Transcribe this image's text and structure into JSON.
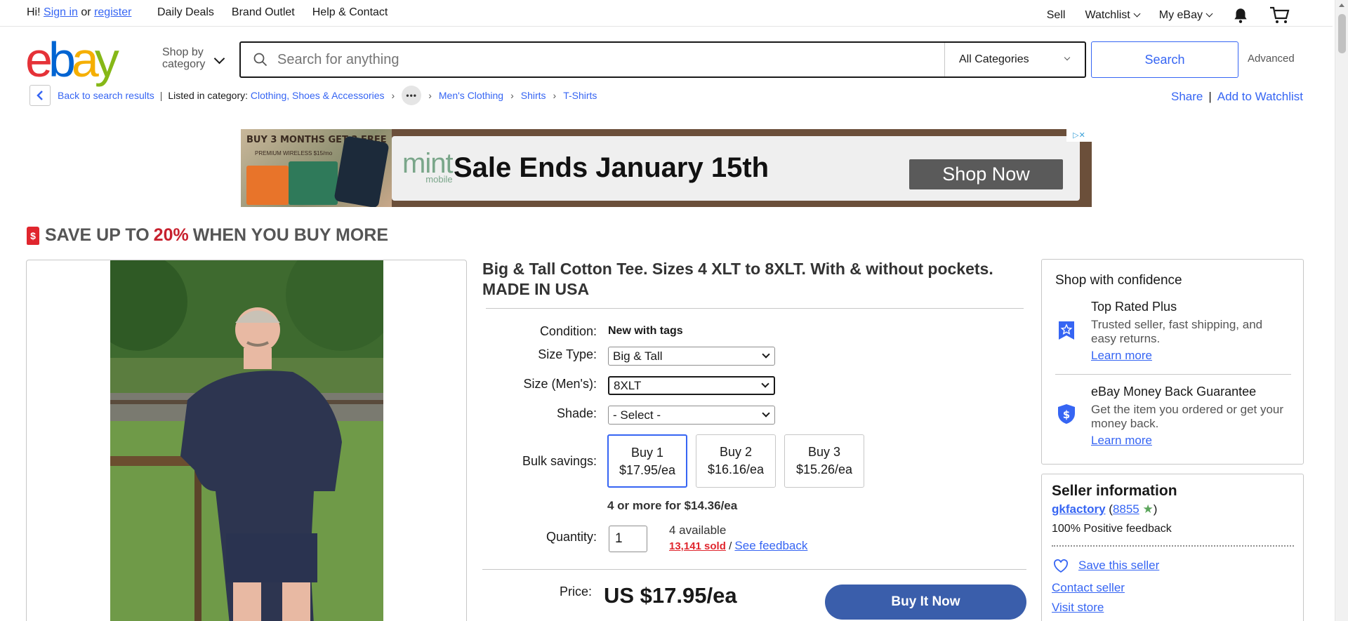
{
  "topbar": {
    "greeting": "Hi!",
    "sign_in": "Sign in",
    "or": "or",
    "register": "register",
    "nav": [
      "Daily Deals",
      "Brand Outlet",
      "Help & Contact"
    ],
    "sell": "Sell",
    "watchlist": "Watchlist",
    "my_ebay": "My eBay"
  },
  "header": {
    "logo": [
      "e",
      "b",
      "a",
      "y"
    ],
    "shop_by_line1": "Shop by",
    "shop_by_line2": "category",
    "search_placeholder": "Search for anything",
    "category": "All Categories",
    "search_button": "Search",
    "advanced": "Advanced"
  },
  "breadcrumb": {
    "back": "Back to search results",
    "listed_in": "Listed in category:",
    "crumbs": [
      "Clothing, Shoes & Accessories",
      "Men's Clothing",
      "Shirts",
      "T-Shirts"
    ],
    "share": "Share",
    "add_watchlist": "Add to Watchlist"
  },
  "ad": {
    "promo_header": "BUY 3 MONTHS GET 3 FREE",
    "promo_sub": "PREMIUM WIRELESS $15/mo",
    "brand": "mint",
    "brand_sub": "mobile",
    "headline": "Sale Ends January 15th",
    "cta": "Shop Now"
  },
  "promo_banner": {
    "prefix": "SAVE UP TO",
    "percent": "20%",
    "suffix": "WHEN YOU BUY MORE"
  },
  "product": {
    "title": "Big & Tall Cotton Tee. Sizes 4 XLT to 8XLT. With & without pockets. MADE IN USA",
    "condition_label": "Condition:",
    "condition_value": "New with tags",
    "size_type_label": "Size Type:",
    "size_type_value": "Big & Tall",
    "size_label": "Size (Men's):",
    "size_value": "8XLT",
    "shade_label": "Shade:",
    "shade_value": "- Select -",
    "bulk_label": "Bulk savings:",
    "bulk": [
      {
        "qty": "Buy 1",
        "price": "$17.95/ea"
      },
      {
        "qty": "Buy 2",
        "price": "$16.16/ea"
      },
      {
        "qty": "Buy 3",
        "price": "$15.26/ea"
      }
    ],
    "more_note": "4 or more for $14.36/ea",
    "quantity_label": "Quantity:",
    "quantity_value": "1",
    "available": "4 available",
    "sold": "13,141 sold",
    "slash": "/",
    "see_feedback": "See feedback",
    "price_label": "Price:",
    "price": "US $17.95/ea",
    "buy_now": "Buy It Now"
  },
  "confidence": {
    "heading": "Shop with confidence",
    "items": [
      {
        "title": "Top Rated Plus",
        "desc": "Trusted seller, fast shipping, and easy returns.",
        "link": "Learn more"
      },
      {
        "title": "eBay Money Back Guarantee",
        "desc": "Get the item you ordered or get your money back.",
        "link": "Learn more"
      }
    ]
  },
  "seller": {
    "heading": "Seller information",
    "name": "gkfactory",
    "feedback_score": "8855",
    "positive": "100% Positive feedback",
    "save": "Save this seller",
    "contact": "Contact seller",
    "visit": "Visit store"
  },
  "colors": {
    "accent": "#3665f3",
    "buy_now": "#3a5eab",
    "sale_red": "#c7212e"
  }
}
